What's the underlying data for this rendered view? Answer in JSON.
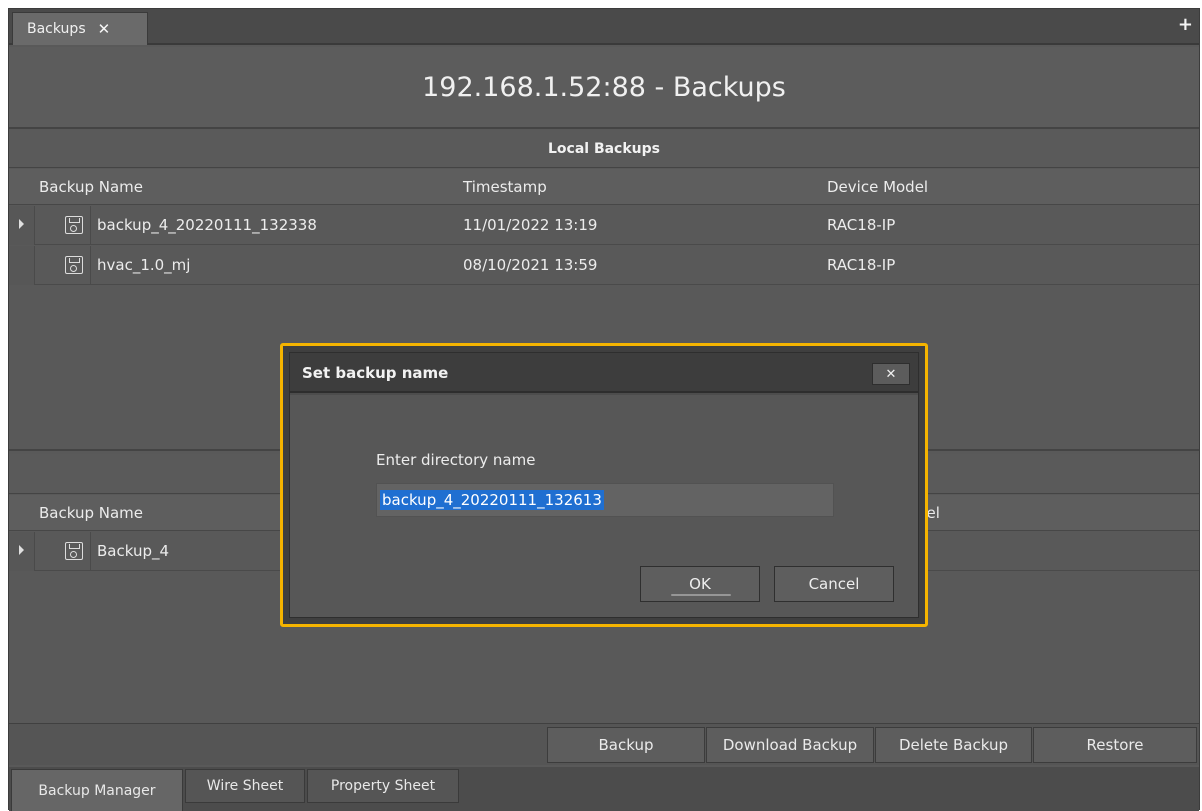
{
  "tabs": {
    "document_tab": "Backups",
    "close_glyph": "✕",
    "add_glyph": "+"
  },
  "header": {
    "title": "192.168.1.52:88 - Backups"
  },
  "local": {
    "section_title": "Local Backups",
    "columns": [
      "Backup Name",
      "Timestamp",
      "Device Model"
    ],
    "rows": [
      {
        "name": "backup_4_20220111_132338",
        "timestamp": "11/01/2022 13:19",
        "model": "RAC18-IP",
        "icon": "floppy-disk-icon"
      },
      {
        "name": "hvac_1.0_mj",
        "timestamp": "08/10/2021 13:59",
        "model": "RAC18-IP",
        "icon": "floppy-disk-icon"
      }
    ]
  },
  "remote": {
    "column_name": "Backup Name",
    "column_model_partial": "del",
    "rows": [
      {
        "name": "Backup_4",
        "icon": "floppy-disk-icon"
      }
    ]
  },
  "dialog": {
    "title": "Set backup name",
    "close_glyph": "✕",
    "prompt": "Enter directory name",
    "input_value": "backup_4_20220111_132613",
    "ok_label": "OK",
    "cancel_label": "Cancel",
    "highlight_color": "#f5b400"
  },
  "actions": {
    "backup": "Backup",
    "download_backup": "Download Backup",
    "delete_backup": "Delete Backup",
    "restore": "Restore"
  },
  "bottom_tabs": {
    "backup_manager": "Backup Manager",
    "wire_sheet": "Wire Sheet",
    "property_sheet": "Property Sheet"
  }
}
